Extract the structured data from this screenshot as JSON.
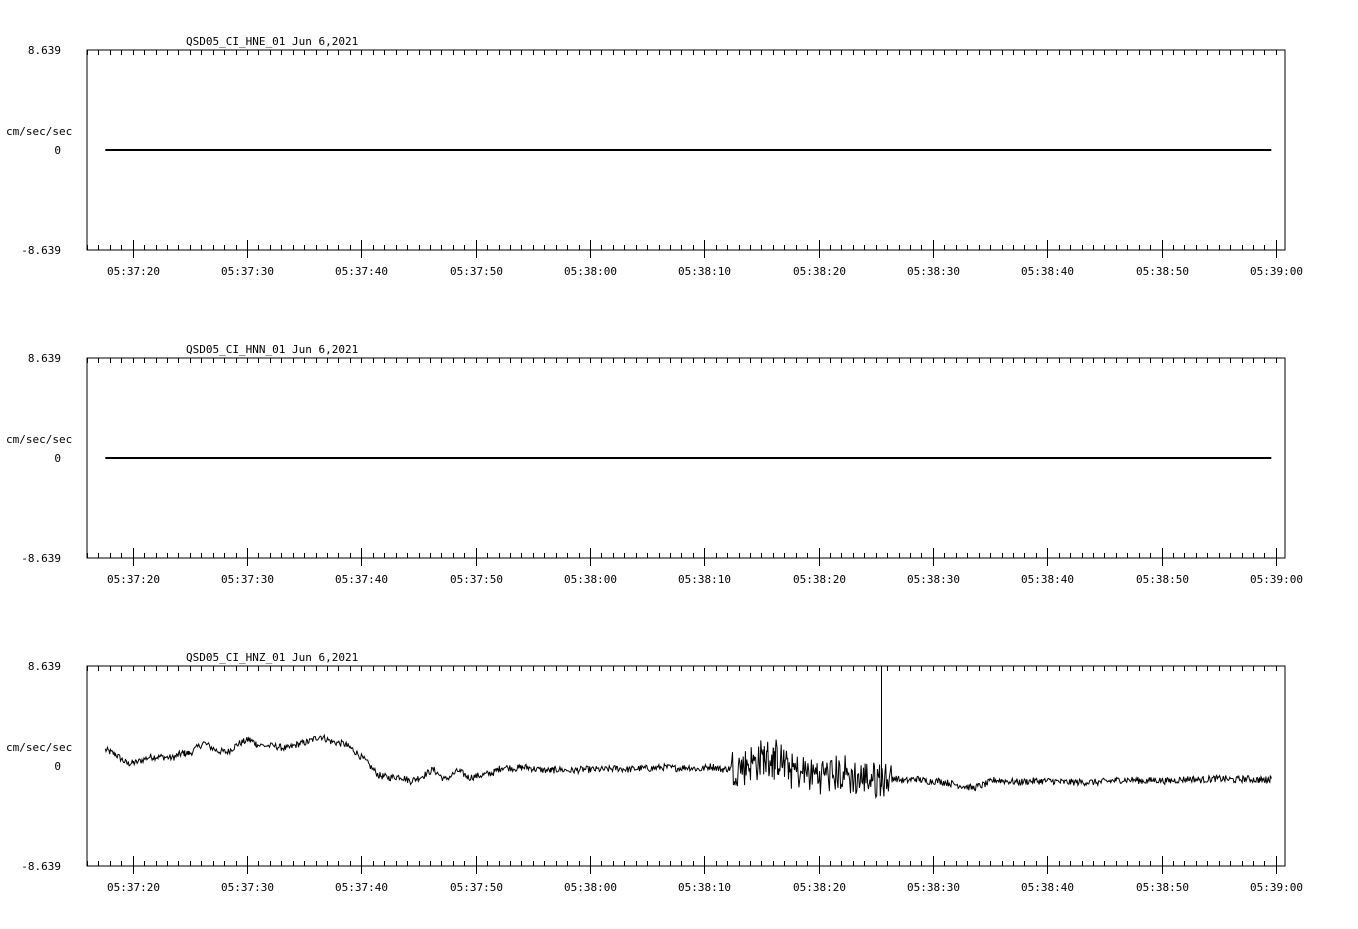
{
  "chart_data": [
    {
      "type": "line",
      "title": "QSD05_CI_HNE_01  Jun 6,2021",
      "ylabel": "cm/sec/sec",
      "ylim": [
        -8.639,
        8.639
      ],
      "ytick_labels": [
        "8.639",
        "0",
        "-8.639"
      ],
      "xtick_labels": [
        "05:37:20",
        "05:37:30",
        "05:37:40",
        "05:37:50",
        "05:38:00",
        "05:38:10",
        "05:38:20",
        "05:38:30",
        "05:38:40",
        "05:38:50",
        "05:39:00"
      ],
      "xlim": [
        -4.0,
        100.8
      ],
      "grid": false,
      "series": [
        {
          "x": [
            -2.4,
            99.6
          ],
          "values": [
            0,
            0
          ]
        }
      ]
    },
    {
      "type": "line",
      "title": "QSD05_CI_HNN_01  Jun 6,2021",
      "ylabel": "cm/sec/sec",
      "ylim": [
        -8.639,
        8.639
      ],
      "ytick_labels": [
        "8.639",
        "0",
        "-8.639"
      ],
      "xtick_labels": [
        "05:37:20",
        "05:37:30",
        "05:37:40",
        "05:37:50",
        "05:38:00",
        "05:38:10",
        "05:38:20",
        "05:38:30",
        "05:38:40",
        "05:38:50",
        "05:39:00"
      ],
      "xlim": [
        -4.0,
        100.8
      ],
      "grid": false,
      "series": [
        {
          "x": [
            -2.4,
            99.6
          ],
          "values": [
            0,
            0
          ]
        }
      ]
    },
    {
      "type": "line",
      "title": "QSD05_CI_HNZ_01  Jun 6,2021",
      "ylabel": "cm/sec/sec",
      "ylim": [
        -8.639,
        8.639
      ],
      "ytick_labels": [
        "8.639",
        "0",
        "-8.639"
      ],
      "xtick_labels": [
        "05:37:20",
        "05:37:30",
        "05:37:40",
        "05:37:50",
        "05:38:00",
        "05:38:10",
        "05:38:20",
        "05:38:30",
        "05:38:40",
        "05:38:50",
        "05:39:00"
      ],
      "xlim": [
        -4.0,
        100.8
      ],
      "grid": false,
      "series": [
        {
          "x": [
            -2.4,
            -1.5,
            -0.5,
            0.3,
            1.5,
            2.4,
            3.5,
            4.3,
            5.0,
            6.2,
            7.4,
            8.3,
            9.2,
            10.2,
            11.0,
            12.5,
            13.5,
            14.5,
            15.4,
            16.4,
            17.4,
            18.5,
            19.3,
            20.4,
            21.5,
            22.4,
            23.4,
            24.3,
            25.3,
            26.3,
            27.3,
            28.5,
            29.4,
            30.5,
            31.5,
            32.3,
            33.5,
            34.4,
            35.4,
            36.5,
            37.2,
            38.4,
            39.4,
            40.4,
            41.4,
            42.4,
            43.4,
            44.4,
            45.4,
            46.5,
            47.6,
            48.6,
            49.6,
            50.6,
            51.5,
            52.4,
            53.4,
            54.3,
            55.2,
            55.9,
            56.5,
            57.3,
            58.2,
            59.3,
            60.3,
            61.3,
            62.4,
            63.5,
            64.5,
            65.4,
            66.5,
            67.5,
            68.5,
            69.4,
            70.5,
            71.5,
            72.5,
            73.5,
            74.5,
            75.4,
            76.4,
            77.5,
            78.5,
            79.5,
            80.5,
            81.4,
            82.4,
            83.4,
            84.5,
            85.5,
            86.4,
            87.5,
            88.5,
            89.5,
            90.5,
            91.5,
            92.5,
            93.5,
            94.5,
            95.4,
            96.4,
            97.4,
            98.4,
            99.0,
            99.6
          ],
          "values": [
            1.4,
            1.0,
            0.2,
            0.3,
            0.8,
            0.8,
            0.7,
            1.1,
            1.1,
            2.0,
            1.3,
            1.2,
            1.9,
            2.3,
            1.8,
            1.7,
            1.5,
            1.9,
            2.1,
            2.6,
            2.1,
            1.9,
            1.4,
            0.4,
            -0.8,
            -1.0,
            -0.9,
            -1.3,
            -0.9,
            -0.3,
            -1.2,
            -0.4,
            -1.0,
            -0.8,
            -0.6,
            -0.1,
            -0.2,
            -0.1,
            -0.3,
            -0.4,
            -0.3,
            -0.4,
            -0.3,
            -0.3,
            -0.3,
            -0.2,
            -0.3,
            -0.2,
            -0.2,
            -0.1,
            -0.2,
            -0.1,
            -0.3,
            0.0,
            -0.3,
            -0.2,
            0.1,
            0.3,
            0.7,
            0.6,
            0.5,
            -0.1,
            -0.5,
            -0.7,
            -0.7,
            -0.6,
            -0.8,
            -1.2,
            -1.0,
            -1.1,
            -1.0,
            -1.3,
            -1.1,
            -1.3,
            -1.3,
            -1.5,
            -1.7,
            -1.9,
            -1.6,
            -1.2,
            -1.3,
            -1.4,
            -1.3,
            -1.3,
            -1.3,
            -1.4,
            -1.4,
            -1.4,
            -1.4,
            -1.3,
            -1.2,
            -1.2,
            -1.3,
            -1.2,
            -1.3,
            -1.2,
            -1.1,
            -1.2,
            -1.1,
            -1.1,
            -1.2,
            -1.1,
            -1.2,
            -1.2,
            -1.1
          ]
        }
      ]
    }
  ]
}
